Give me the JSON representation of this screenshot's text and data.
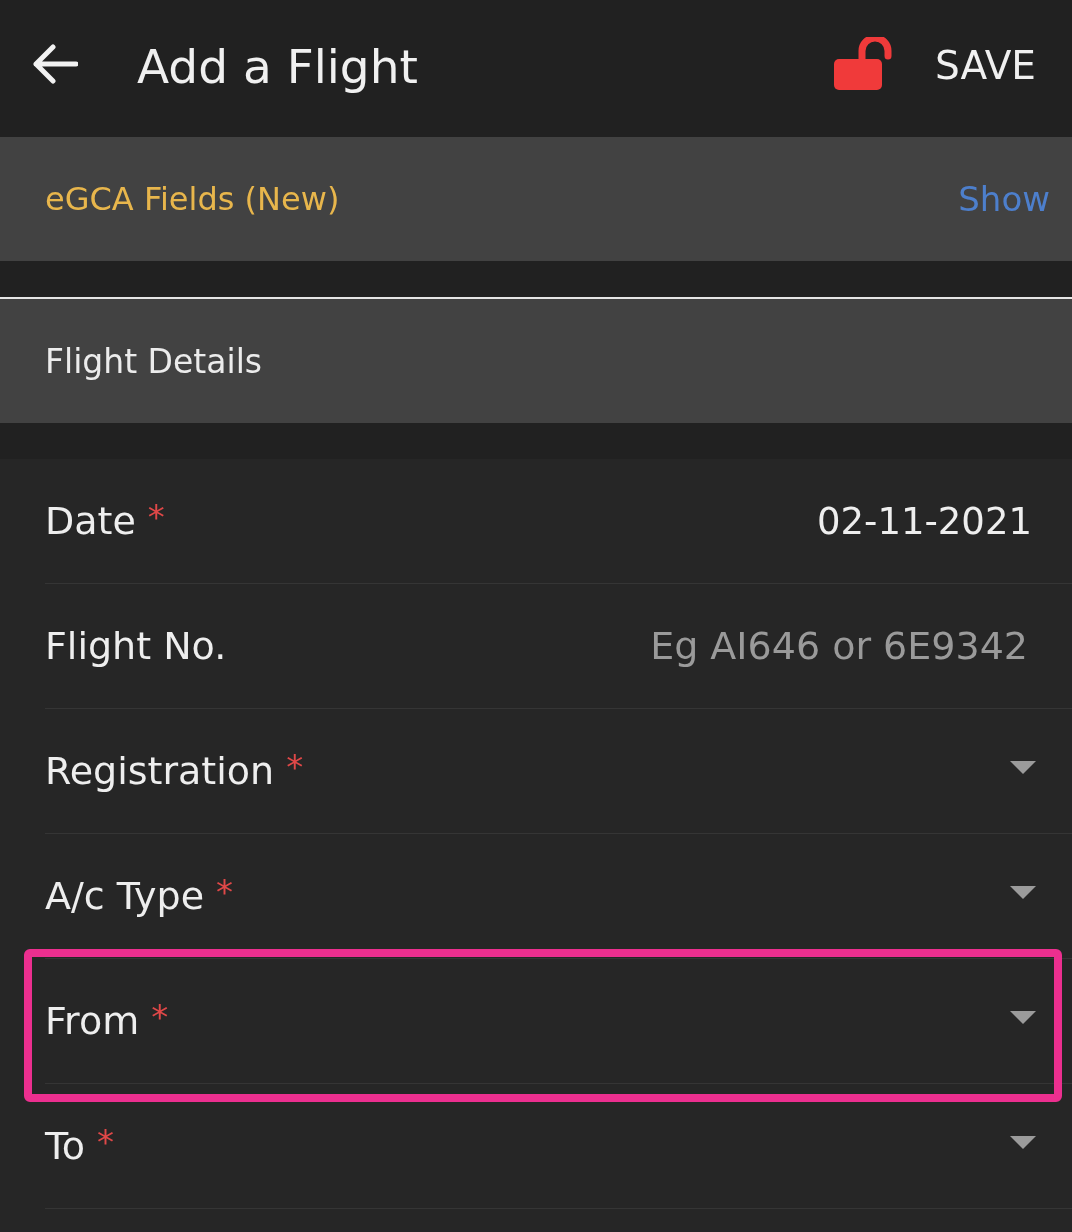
{
  "app_bar": {
    "title": "Add a Flight",
    "action": "SAVE"
  },
  "egca_section": {
    "title": "eGCA Fields (New)",
    "toggle": "Show"
  },
  "flight_details": {
    "title": "Flight Details",
    "fields": [
      {
        "label": "Date",
        "required_mark": "*",
        "kind": "date",
        "value": "02-11-2021",
        "highlighted": false
      },
      {
        "label": "Flight No.",
        "kind": "text",
        "placeholder": "Eg AI646 or 6E9342",
        "highlighted": false
      },
      {
        "label": "Registration",
        "required_mark": "*",
        "kind": "dropdown",
        "highlighted": false
      },
      {
        "label": "A/c Type",
        "required_mark": "*",
        "kind": "dropdown",
        "highlighted": false
      },
      {
        "label": "From",
        "required_mark": "*",
        "kind": "dropdown",
        "highlighted": true
      },
      {
        "label": "To",
        "required_mark": "*",
        "kind": "dropdown",
        "highlighted": false
      }
    ]
  }
}
